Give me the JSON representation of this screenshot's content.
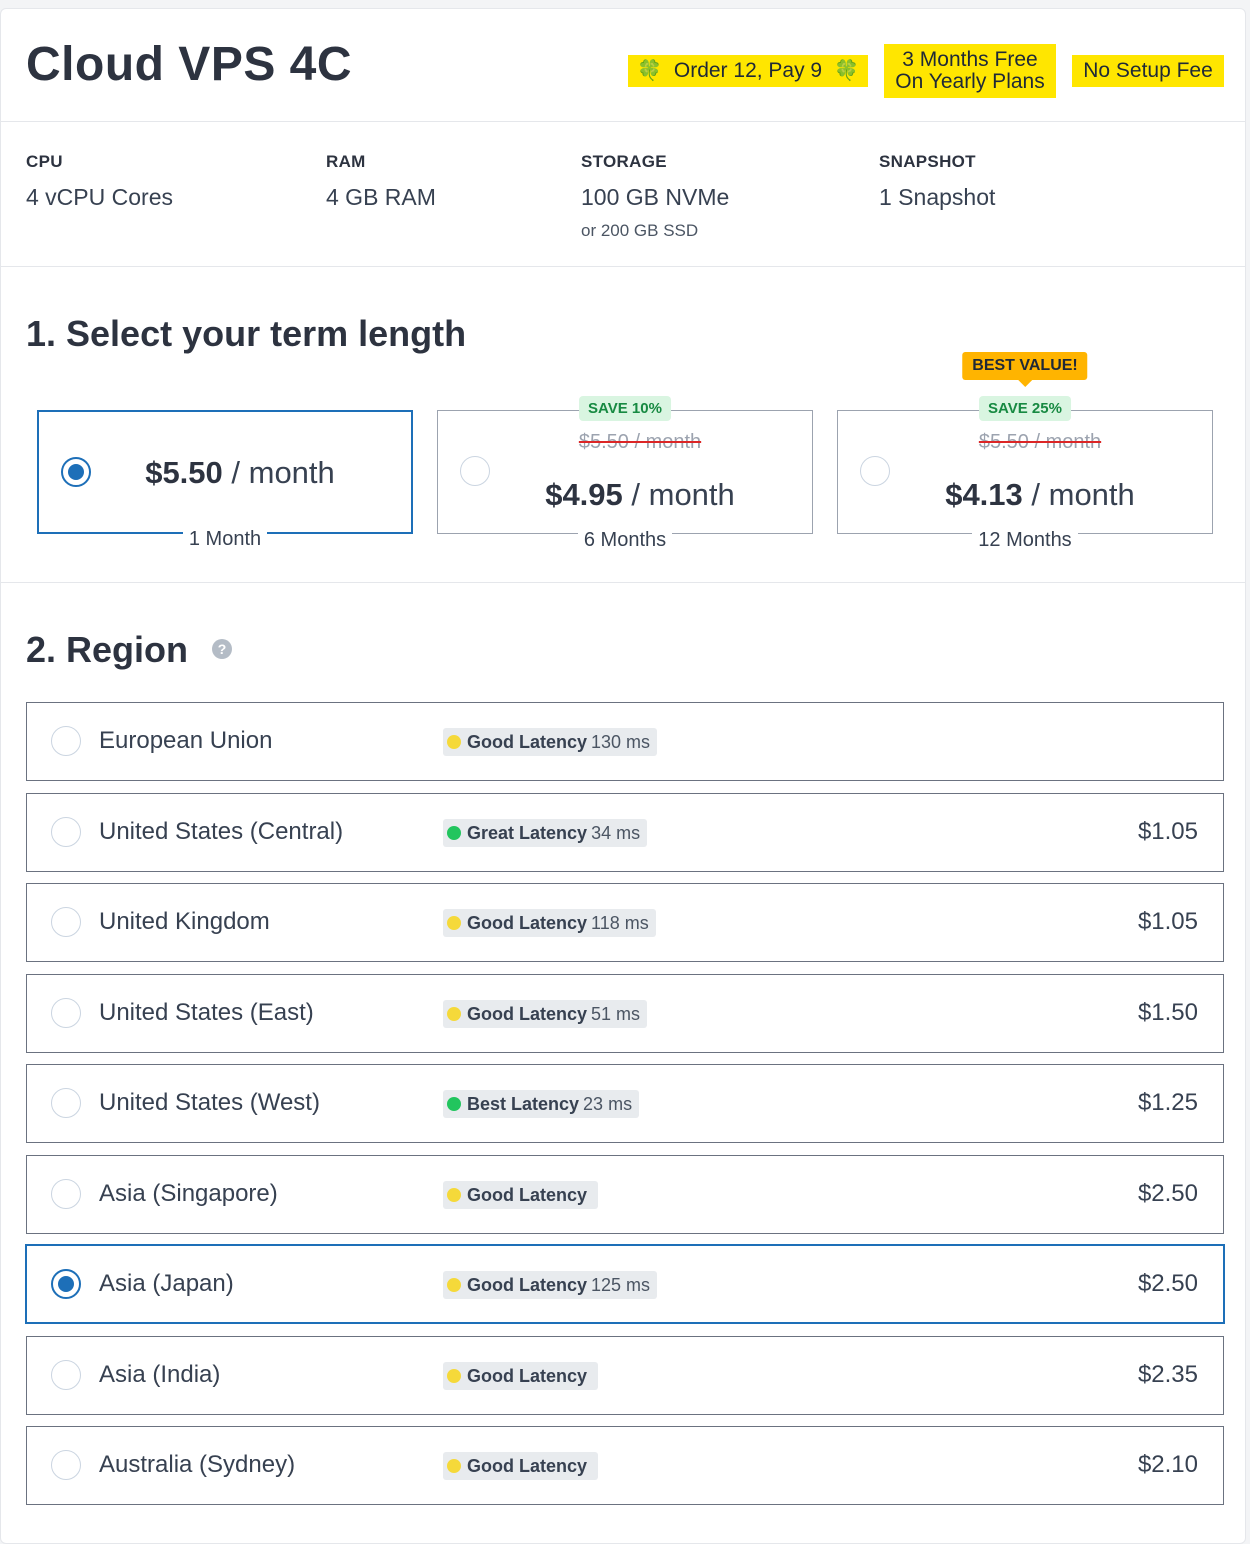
{
  "product": {
    "title": "Cloud VPS 4C",
    "badges": {
      "promo1": "Order 12, Pay 9",
      "promo2_line1": "3 Months Free",
      "promo2_line2": "On Yearly Plans",
      "promo3": "No Setup Fee"
    },
    "clover_icon": "🍀",
    "badge_color": "#ffe600"
  },
  "specs": [
    {
      "label": "CPU",
      "value": "4 vCPU Cores",
      "sub": ""
    },
    {
      "label": "RAM",
      "value": "4 GB RAM",
      "sub": ""
    },
    {
      "label": "STORAGE",
      "value": "100 GB NVMe",
      "sub": "or 200 GB SSD"
    },
    {
      "label": "SNAPSHOT",
      "value": "1 Snapshot",
      "sub": ""
    }
  ],
  "term_section": {
    "title": "1. Select your term length",
    "options": [
      {
        "price": "$5.50",
        "unit": " / month",
        "old_price": "",
        "label": "1 Month",
        "save": "",
        "best": "",
        "selected": true
      },
      {
        "price": "$4.95",
        "unit": " / month",
        "old_price": "$5.50 / month",
        "label": "6 Months",
        "save": "SAVE 10%",
        "best": "",
        "selected": false
      },
      {
        "price": "$4.13",
        "unit": " / month",
        "old_price": "$5.50 / month",
        "label": "12 Months",
        "save": "SAVE 25%",
        "best": "BEST VALUE!",
        "selected": false
      }
    ]
  },
  "region_section": {
    "title": "2. Region",
    "help_icon": "?",
    "regions": [
      {
        "name": "European Union",
        "latency_label": "Good Latency",
        "latency_ms": "130 ms",
        "latency_color": "#f5d93a",
        "price": "",
        "selected": false
      },
      {
        "name": "United States (Central)",
        "latency_label": "Great Latency",
        "latency_ms": "34 ms",
        "latency_color": "#22c55e",
        "price": "$1.05",
        "selected": false
      },
      {
        "name": "United Kingdom",
        "latency_label": "Good Latency",
        "latency_ms": "118 ms",
        "latency_color": "#f5d93a",
        "price": "$1.05",
        "selected": false
      },
      {
        "name": "United States (East)",
        "latency_label": "Good Latency",
        "latency_ms": "51 ms",
        "latency_color": "#f5d93a",
        "price": "$1.50",
        "selected": false
      },
      {
        "name": "United States (West)",
        "latency_label": "Best Latency",
        "latency_ms": "23 ms",
        "latency_color": "#22c55e",
        "price": "$1.25",
        "selected": false
      },
      {
        "name": "Asia (Singapore)",
        "latency_label": "Good Latency",
        "latency_ms": "",
        "latency_color": "#f5d93a",
        "price": "$2.50",
        "selected": false
      },
      {
        "name": "Asia (Japan)",
        "latency_label": "Good Latency",
        "latency_ms": "125 ms",
        "latency_color": "#f5d93a",
        "price": "$2.50",
        "selected": true
      },
      {
        "name": "Asia (India)",
        "latency_label": "Good Latency",
        "latency_ms": "",
        "latency_color": "#f5d93a",
        "price": "$2.35",
        "selected": false
      },
      {
        "name": "Australia (Sydney)",
        "latency_label": "Good Latency",
        "latency_ms": "",
        "latency_color": "#f5d93a",
        "price": "$2.10",
        "selected": false
      }
    ]
  },
  "accent_color": "#1d6fb8"
}
